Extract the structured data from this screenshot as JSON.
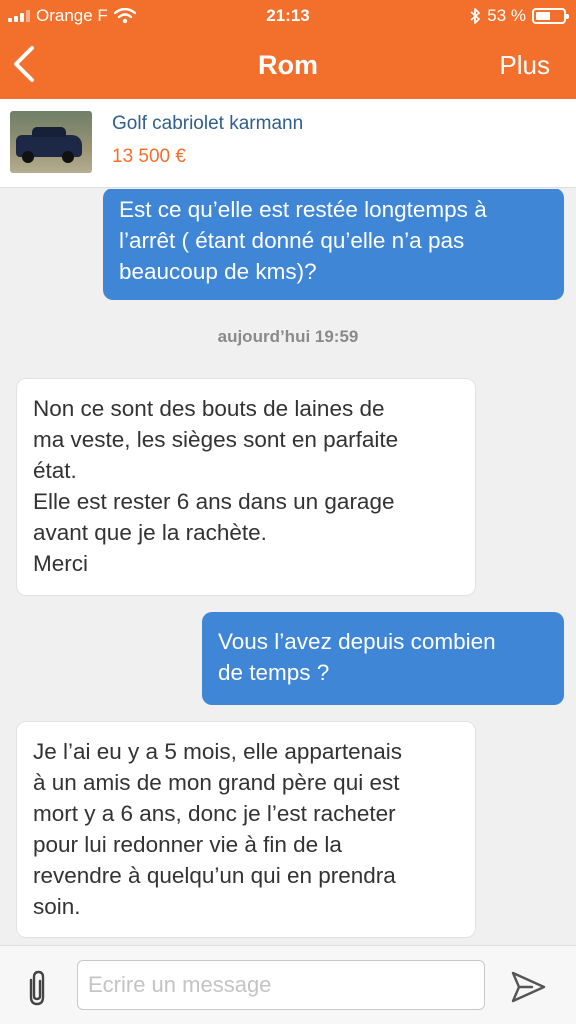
{
  "status_bar": {
    "carrier": "Orange F",
    "time": "21:13",
    "battery_text": "53 %",
    "battery_level": 0.53
  },
  "nav": {
    "back_icon": "chevron-left-icon",
    "title": "Rom",
    "more_label": "Plus"
  },
  "listing": {
    "title": "Golf cabriolet karmann",
    "price": "13 500 €"
  },
  "messages": [
    {
      "direction": "out",
      "text": "Est ce qu’elle est restée longtemps à\nl’arrêt ( étant donné qu’elle n’a pas\nbeaucoup de kms)?"
    },
    {
      "direction": "in",
      "text": "Non ce sont des bouts de laines de\nma veste, les sièges sont en parfaite\nétat.\nElle est rester 6 ans dans un garage\navant que je la rachète.\nMerci"
    },
    {
      "direction": "out",
      "text": "Vous l’avez depuis combien\nde temps ?"
    },
    {
      "direction": "in",
      "text": "Je l’ai eu y a 5 mois, elle appartenais\nà un amis de mon grand père qui est\nmort y a 6 ans, donc je l’est racheter\npour lui redonner vie à fin de la\nrevendre à quelqu’un qui en prendra\nsoin."
    }
  ],
  "date_separator": "aujourd’hui 19:59",
  "composer": {
    "placeholder": "Ecrire un message",
    "attach_icon": "paperclip-icon",
    "send_icon": "send-icon"
  },
  "colors": {
    "brand": "#f36f2c",
    "outgoing_bubble": "#3f86d6",
    "listing_title": "#2f5f8f"
  }
}
